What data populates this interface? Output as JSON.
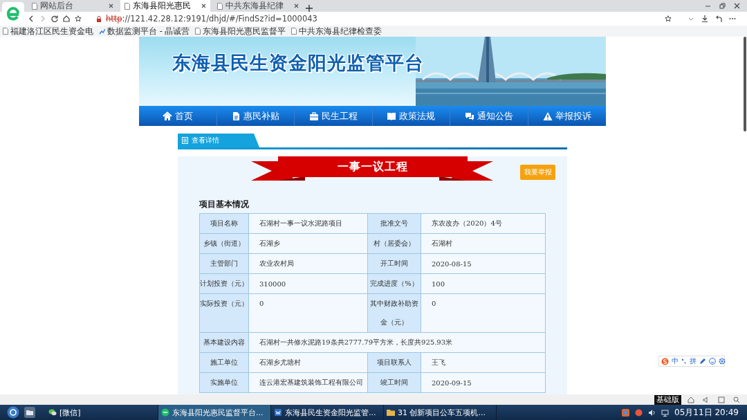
{
  "browser": {
    "tabs": [
      {
        "title": "网站后台",
        "selected": false
      },
      {
        "title": "东海县阳光惠民",
        "selected": true
      },
      {
        "title": "中共东海县纪律",
        "selected": false
      }
    ],
    "address": {
      "scheme": "http",
      "rest": "://121.42.28.12:9191/dhjd/#/FindSz?id=1000043"
    },
    "bookmarks": [
      {
        "title": "福建洛江区民生资金电",
        "kind": "page"
      },
      {
        "title": "数据监测平台 - 晶诚营",
        "kind": "app"
      },
      {
        "title": "东海县阳光惠民监督平",
        "kind": "page"
      },
      {
        "title": "中共东海县纪律检查委",
        "kind": "page"
      }
    ]
  },
  "site": {
    "title": "东海县民生资金阳光监管平台",
    "nav": [
      {
        "label": "首页",
        "kind": "home"
      },
      {
        "label": "惠民补贴",
        "kind": "file"
      },
      {
        "label": "民生工程",
        "kind": "briefcase"
      },
      {
        "label": "政策法规",
        "kind": "book"
      },
      {
        "label": "通知公告",
        "kind": "chat"
      },
      {
        "label": "举报投诉",
        "kind": "warning"
      }
    ],
    "detail_tab": "查看详情",
    "ribbon": "一事一议工程",
    "report_button": "我要举报",
    "section_title": "项目基本情况",
    "rows": [
      {
        "kind": "pair",
        "cells": [
          {
            "label": "项目名称",
            "value": "石湖村一事一议水泥路项目"
          },
          {
            "label": "批准文号",
            "value": "东农改办（2020）4号"
          }
        ]
      },
      {
        "kind": "pair",
        "cells": [
          {
            "label": "乡镇（街道）",
            "value": "石湖乡"
          },
          {
            "label": "村（居委会）",
            "value": "石湖村"
          }
        ]
      },
      {
        "kind": "pair",
        "cells": [
          {
            "label": "主管部门",
            "value": "农业农村局"
          },
          {
            "label": "开工时间",
            "value": "2020-08-15"
          }
        ]
      },
      {
        "kind": "pair",
        "cells": [
          {
            "label": "计划投资（元）",
            "value": "310000"
          },
          {
            "label": "完成进度（%）",
            "value": "100"
          }
        ]
      },
      {
        "kind": "pair",
        "cells": [
          {
            "label": "实际投资（元）",
            "value": "0"
          },
          {
            "label": "其中财政补助资金（元）",
            "value": "0"
          }
        ]
      },
      {
        "kind": "wide",
        "label": "基本建设内容",
        "value": "石湖村一共修水泥路19条共2777.79平方米，长度共925.93米"
      },
      {
        "kind": "pair",
        "cells": [
          {
            "label": "施工单位",
            "value": "石湖乡尤塘村"
          },
          {
            "label": "项目联系人",
            "value": "王飞"
          }
        ]
      },
      {
        "kind": "pair",
        "cells": [
          {
            "label": "实施单位",
            "value": "连云港宏基建筑装饰工程有限公司"
          },
          {
            "label": "竣工时间",
            "value": "2020-09-15"
          }
        ]
      }
    ]
  },
  "ime": {
    "items": [
      "中",
      "拼"
    ]
  },
  "edition_badge": "基础版",
  "taskbar": {
    "items": [
      {
        "label": "[微信]",
        "kind": "chat",
        "selected": false
      },
      {
        "label": "东海县阳光惠民监督平台...",
        "kind": "browser",
        "selected": true
      },
      {
        "label": "东海县民生资金阳光监管...",
        "kind": "document",
        "selected": false
      },
      {
        "label": "31  创新项目公车五项机...",
        "kind": "folder",
        "selected": false
      }
    ],
    "clock": "05月11日 20:49"
  }
}
